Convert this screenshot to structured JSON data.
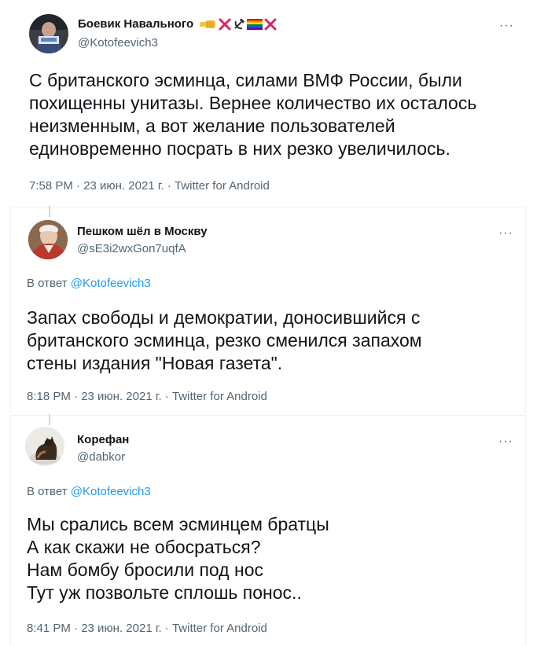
{
  "tweets": [
    {
      "author_name": "Боевик Навального",
      "handle": "@Kotofeevich3",
      "name_emoji": [
        "fist-icon",
        "red-x-icon",
        "hammer-sickle-icon",
        "rainbow-flag-icon",
        "red-x-icon"
      ],
      "more": "···",
      "text": "С британского эсминца, силами ВМФ России, были\nпохищенны унитазы. Вернее количество их осталось\nнеизменным, а вот желание пользователей\nединовременно посрать в них резко увеличилось.",
      "timestamp": "7:58 PM · 23 июн. 2021 г. · Twitter for Android"
    },
    {
      "author_name": "Пешком шёл в Москву",
      "handle": "@sE3i2wxGon7uqfA",
      "more": "···",
      "reply_prefix": "В ответ ",
      "reply_mention": "@Kotofeevich3",
      "text": "Запах свободы и демократии, доносившийся с\nбританского эсминца, резко сменился запахом\nстены издания \"Новая газета\".",
      "timestamp": "8:18 PM · 23 июн. 2021 г. · Twitter for Android"
    },
    {
      "author_name": "Корефан",
      "handle": "@dabkor",
      "more": "···",
      "reply_prefix": "В ответ ",
      "reply_mention": "@Kotofeevich3",
      "text": "Мы срались всем эсминцем братцы\nА как скажи не обосраться?\nНам бомбу бросили под нос\nТут уж позвольте сплошь понос..",
      "timestamp": "8:41 PM · 23 июн. 2021 г. · Twitter for Android"
    }
  ],
  "colors": {
    "text": "#0f1419",
    "secondary": "#536471",
    "link": "#1d9bf0",
    "divider": "#eff3f4"
  }
}
